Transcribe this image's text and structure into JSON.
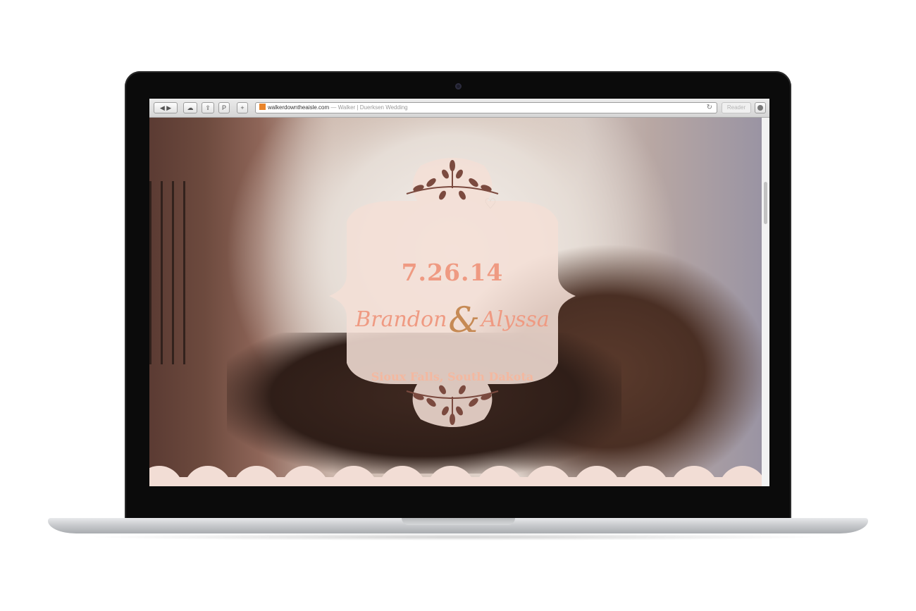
{
  "browser": {
    "nav": {
      "back_icon": "back-arrow-icon",
      "forward_icon": "forward-arrow-icon"
    },
    "url": "walkerdowntheaisle.com",
    "page_title": "— Walker | Duerksen Wedding",
    "reader_label": "Reader"
  },
  "site": {
    "date": "7.26.14",
    "name_first": "Brandon",
    "ampersand": "&",
    "name_second": "Alyssa",
    "location": "Sioux Falls, South Dakota"
  },
  "colors": {
    "accent": "#ef9a82",
    "emblem_fill": "#f3dfd6",
    "scallop": "#f2ddd5",
    "leaf": "#7b4a3f"
  }
}
